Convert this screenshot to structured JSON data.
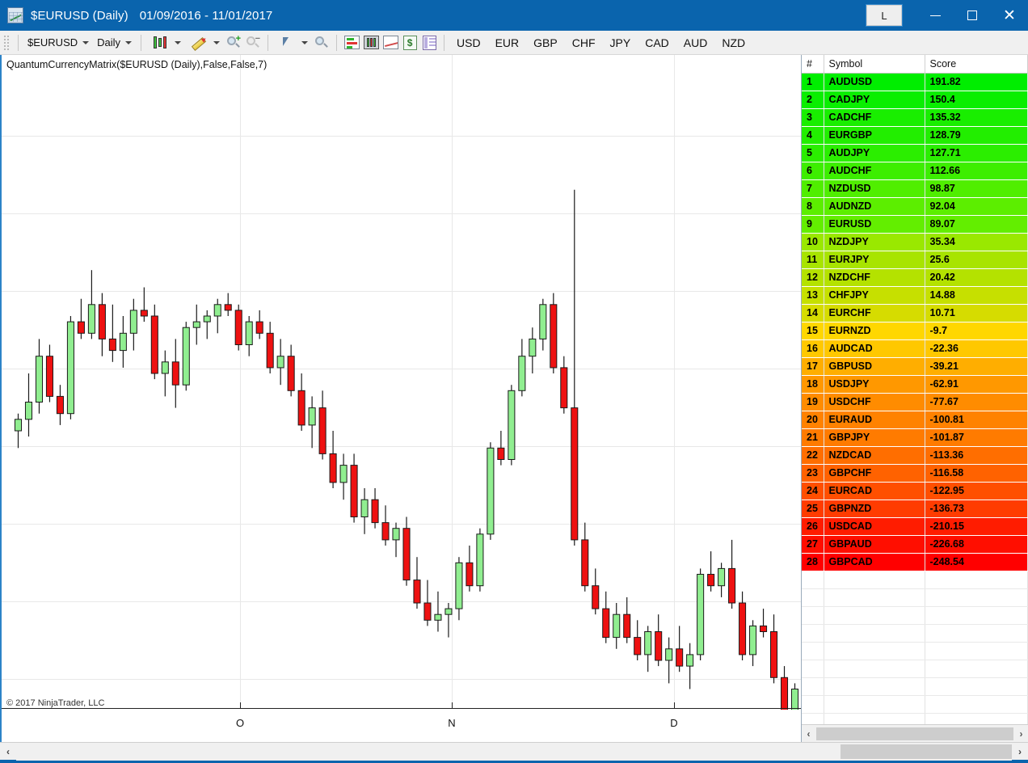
{
  "window": {
    "title": "$EURUSD (Daily)",
    "date_range": "01/09/2016 - 11/01/2017",
    "icon": "chart-icon",
    "link_button": "L",
    "minimize": "–",
    "maximize": "□",
    "close": "✕",
    "titlebar_color": "#0a64ad"
  },
  "toolbar": {
    "instrument": "$EURUSD",
    "interval": "Daily",
    "icons": [
      "candlestick-type-icon",
      "drawing-tools-icon",
      "zoom-in-icon",
      "zoom-out-icon",
      "cursor-tool-icon",
      "magnifier-icon",
      "bar-chart-icon",
      "candle-panel-icon",
      "line-chart-icon",
      "dollar-icon",
      "data-panel-icon"
    ],
    "currencies": [
      "USD",
      "EUR",
      "GBP",
      "CHF",
      "JPY",
      "CAD",
      "AUD",
      "NZD"
    ]
  },
  "chart": {
    "indicator_label": "QuantumCurrencyMatrix($EURUSD (Daily),False,False,7)",
    "copyright": "© 2017 NinjaTrader, LLC",
    "x_labels": [
      "O",
      "N",
      "D"
    ],
    "up_color": "#90ee90",
    "down_color": "#ee1111",
    "outline_color": "#1a1a1a"
  },
  "matrix": {
    "columns": [
      "#",
      "Symbol",
      "Score"
    ],
    "rows": [
      {
        "rank": "1",
        "symbol": "AUDUSD",
        "score": "191.82",
        "color": "#00ee00"
      },
      {
        "rank": "2",
        "symbol": "CADJPY",
        "score": "150.4",
        "color": "#0aee00"
      },
      {
        "rank": "3",
        "symbol": "CADCHF",
        "score": "135.32",
        "color": "#19ee00"
      },
      {
        "rank": "4",
        "symbol": "EURGBP",
        "score": "128.79",
        "color": "#22ee00"
      },
      {
        "rank": "5",
        "symbol": "AUDJPY",
        "score": "127.71",
        "color": "#2bee00"
      },
      {
        "rank": "6",
        "symbol": "AUDCHF",
        "score": "112.66",
        "color": "#3dee00"
      },
      {
        "rank": "7",
        "symbol": "NZDUSD",
        "score": "98.87",
        "color": "#50ee00"
      },
      {
        "rank": "8",
        "symbol": "AUDNZD",
        "score": "92.04",
        "color": "#5cee00"
      },
      {
        "rank": "9",
        "symbol": "EURUSD",
        "score": "89.07",
        "color": "#63ee00"
      },
      {
        "rank": "10",
        "symbol": "NZDJPY",
        "score": "35.34",
        "color": "#9ae800"
      },
      {
        "rank": "11",
        "symbol": "EURJPY",
        "score": "25.6",
        "color": "#a8e400"
      },
      {
        "rank": "12",
        "symbol": "NZDCHF",
        "score": "20.42",
        "color": "#b4e200"
      },
      {
        "rank": "13",
        "symbol": "CHFJPY",
        "score": "14.88",
        "color": "#c6e000"
      },
      {
        "rank": "14",
        "symbol": "EURCHF",
        "score": "10.71",
        "color": "#d6dc00"
      },
      {
        "rank": "15",
        "symbol": "EURNZD",
        "score": "-9.7",
        "color": "#ffd700"
      },
      {
        "rank": "16",
        "symbol": "AUDCAD",
        "score": "-22.36",
        "color": "#ffc800"
      },
      {
        "rank": "17",
        "symbol": "GBPUSD",
        "score": "-39.21",
        "color": "#ffae00"
      },
      {
        "rank": "18",
        "symbol": "USDJPY",
        "score": "-62.91",
        "color": "#ff9800"
      },
      {
        "rank": "19",
        "symbol": "USDCHF",
        "score": "-77.67",
        "color": "#ff8c00"
      },
      {
        "rank": "20",
        "symbol": "EURAUD",
        "score": "-100.81",
        "color": "#ff8200"
      },
      {
        "rank": "21",
        "symbol": "GBPJPY",
        "score": "-101.87",
        "color": "#ff7b00"
      },
      {
        "rank": "22",
        "symbol": "NZDCAD",
        "score": "-113.36",
        "color": "#ff6e00"
      },
      {
        "rank": "23",
        "symbol": "GBPCHF",
        "score": "-116.58",
        "color": "#ff6200"
      },
      {
        "rank": "24",
        "symbol": "EURCAD",
        "score": "-122.95",
        "color": "#ff4f00"
      },
      {
        "rank": "25",
        "symbol": "GBPNZD",
        "score": "-136.73",
        "color": "#ff3c00"
      },
      {
        "rank": "26",
        "symbol": "USDCAD",
        "score": "-210.15",
        "color": "#ff1c00"
      },
      {
        "rank": "27",
        "symbol": "GBPAUD",
        "score": "-226.68",
        "color": "#ff0e00"
      },
      {
        "rank": "28",
        "symbol": "GBPCAD",
        "score": "-248.54",
        "color": "#ff0000"
      }
    ],
    "scroll_left": "‹",
    "scroll_right": "›"
  },
  "bottom_scroll": {
    "left": "‹",
    "right": "›"
  },
  "chart_data": {
    "type": "candlestick",
    "title": "$EURUSD (Daily) 01/09/2016 - 11/01/2017",
    "xlabel": "",
    "ylabel": "",
    "x_tick_labels": [
      "O",
      "N",
      "D"
    ],
    "x_tick_positions": [
      295,
      557,
      832
    ],
    "grid": true,
    "ohlc": [
      [
        0.5,
        0.53,
        0.47,
        0.52
      ],
      [
        0.52,
        0.6,
        0.49,
        0.55
      ],
      [
        0.55,
        0.66,
        0.53,
        0.63
      ],
      [
        0.63,
        0.65,
        0.55,
        0.56
      ],
      [
        0.56,
        0.58,
        0.51,
        0.53
      ],
      [
        0.53,
        0.7,
        0.52,
        0.69
      ],
      [
        0.69,
        0.73,
        0.66,
        0.67
      ],
      [
        0.67,
        0.78,
        0.66,
        0.72
      ],
      [
        0.72,
        0.74,
        0.63,
        0.66
      ],
      [
        0.66,
        0.72,
        0.62,
        0.64
      ],
      [
        0.64,
        0.7,
        0.61,
        0.67
      ],
      [
        0.67,
        0.73,
        0.64,
        0.71
      ],
      [
        0.71,
        0.75,
        0.69,
        0.7
      ],
      [
        0.7,
        0.72,
        0.59,
        0.6
      ],
      [
        0.6,
        0.64,
        0.56,
        0.62
      ],
      [
        0.62,
        0.66,
        0.54,
        0.58
      ],
      [
        0.58,
        0.69,
        0.57,
        0.68
      ],
      [
        0.68,
        0.72,
        0.65,
        0.69
      ],
      [
        0.69,
        0.71,
        0.66,
        0.7
      ],
      [
        0.7,
        0.73,
        0.67,
        0.72
      ],
      [
        0.72,
        0.74,
        0.7,
        0.71
      ],
      [
        0.71,
        0.72,
        0.64,
        0.65
      ],
      [
        0.65,
        0.7,
        0.63,
        0.69
      ],
      [
        0.69,
        0.71,
        0.66,
        0.67
      ],
      [
        0.67,
        0.69,
        0.6,
        0.61
      ],
      [
        0.61,
        0.66,
        0.58,
        0.63
      ],
      [
        0.63,
        0.65,
        0.56,
        0.57
      ],
      [
        0.57,
        0.6,
        0.5,
        0.51
      ],
      [
        0.51,
        0.56,
        0.47,
        0.54
      ],
      [
        0.54,
        0.57,
        0.45,
        0.46
      ],
      [
        0.46,
        0.5,
        0.4,
        0.41
      ],
      [
        0.41,
        0.46,
        0.38,
        0.44
      ],
      [
        0.44,
        0.46,
        0.34,
        0.35
      ],
      [
        0.35,
        0.4,
        0.32,
        0.38
      ],
      [
        0.38,
        0.4,
        0.33,
        0.34
      ],
      [
        0.34,
        0.37,
        0.3,
        0.31
      ],
      [
        0.31,
        0.34,
        0.28,
        0.33
      ],
      [
        0.33,
        0.35,
        0.23,
        0.24
      ],
      [
        0.24,
        0.28,
        0.19,
        0.2
      ],
      [
        0.2,
        0.24,
        0.16,
        0.17
      ],
      [
        0.17,
        0.22,
        0.15,
        0.18
      ],
      [
        0.18,
        0.2,
        0.14,
        0.19
      ],
      [
        0.19,
        0.28,
        0.17,
        0.27
      ],
      [
        0.27,
        0.3,
        0.22,
        0.23
      ],
      [
        0.23,
        0.33,
        0.22,
        0.32
      ],
      [
        0.32,
        0.48,
        0.31,
        0.47
      ],
      [
        0.47,
        0.5,
        0.44,
        0.45
      ],
      [
        0.45,
        0.58,
        0.44,
        0.57
      ],
      [
        0.57,
        0.66,
        0.56,
        0.63
      ],
      [
        0.63,
        0.68,
        0.6,
        0.66
      ],
      [
        0.66,
        0.73,
        0.64,
        0.72
      ],
      [
        0.72,
        0.74,
        0.6,
        0.61
      ],
      [
        0.61,
        0.63,
        0.53,
        0.54
      ],
      [
        0.54,
        0.92,
        0.3,
        0.31
      ],
      [
        0.31,
        0.34,
        0.22,
        0.23
      ],
      [
        0.23,
        0.26,
        0.18,
        0.19
      ],
      [
        0.19,
        0.22,
        0.13,
        0.14
      ],
      [
        0.14,
        0.2,
        0.12,
        0.18
      ],
      [
        0.18,
        0.21,
        0.13,
        0.14
      ],
      [
        0.14,
        0.17,
        0.1,
        0.11
      ],
      [
        0.11,
        0.16,
        0.08,
        0.15
      ],
      [
        0.15,
        0.18,
        0.09,
        0.1
      ],
      [
        0.1,
        0.14,
        0.06,
        0.12
      ],
      [
        0.12,
        0.16,
        0.08,
        0.09
      ],
      [
        0.09,
        0.13,
        0.05,
        0.11
      ],
      [
        0.11,
        0.26,
        0.1,
        0.25
      ],
      [
        0.25,
        0.29,
        0.22,
        0.23
      ],
      [
        0.23,
        0.27,
        0.21,
        0.26
      ],
      [
        0.26,
        0.31,
        0.19,
        0.2
      ],
      [
        0.2,
        0.22,
        0.1,
        0.11
      ],
      [
        0.11,
        0.17,
        0.09,
        0.16
      ],
      [
        0.16,
        0.19,
        0.14,
        0.15
      ],
      [
        0.15,
        0.18,
        0.06,
        0.07
      ],
      [
        0.07,
        0.09,
        0.0,
        0.01
      ],
      [
        0.01,
        0.06,
        0.0,
        0.05
      ]
    ]
  }
}
